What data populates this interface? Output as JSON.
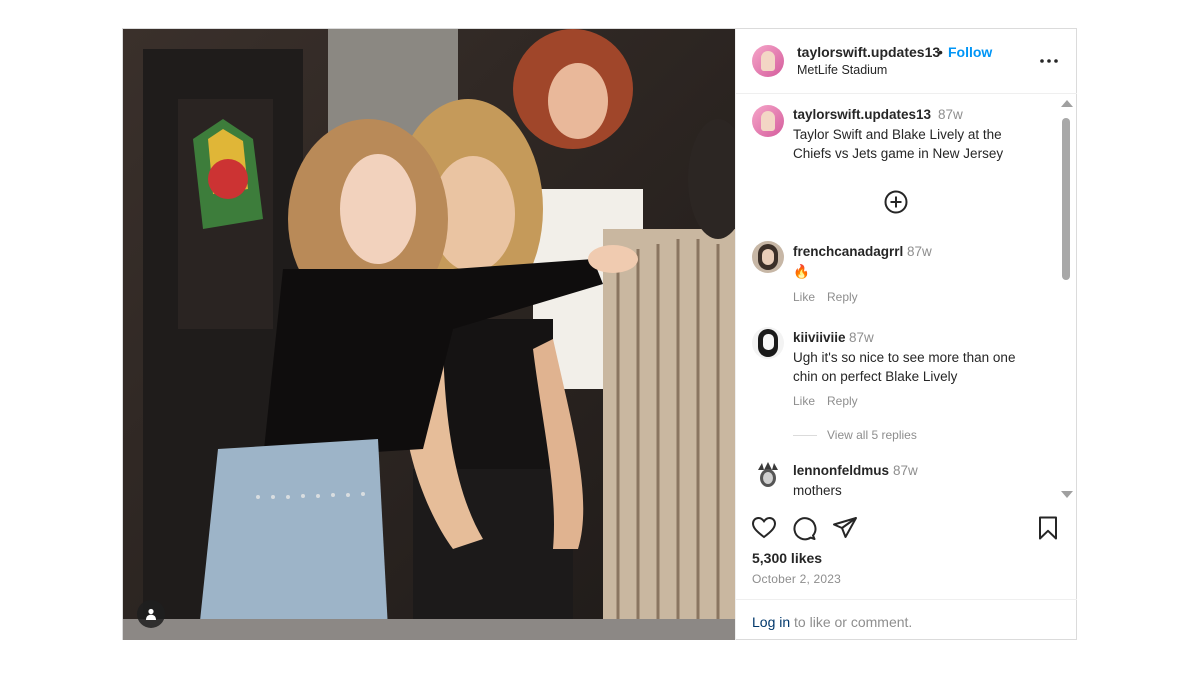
{
  "post": {
    "username": "taylorswift.updates13",
    "separator": "•",
    "follow_label": "Follow",
    "location": "MetLife Stadium",
    "likes": "5,300 likes",
    "date": "October 2, 2023"
  },
  "caption": {
    "username": "taylorswift.updates13",
    "time": "87w",
    "text": "Taylor Swift and Blake Lively at the Chiefs vs Jets game in New Jersey"
  },
  "comments": [
    {
      "username": "frenchcanadagrrl",
      "time": "87w",
      "text": "🔥",
      "like_label": "Like",
      "reply_label": "Reply"
    },
    {
      "username": "kiiviiviie",
      "time": "87w",
      "text": "Ugh it's so nice to see more than one chin on perfect Blake Lively",
      "like_label": "Like",
      "reply_label": "Reply",
      "view_replies": "View all 5 replies"
    },
    {
      "username": "lennonfeldmus",
      "time": "87w",
      "text": "mothers"
    }
  ],
  "footer": {
    "login_link": "Log in",
    "login_rest": " to like or comment."
  },
  "colors": {
    "follow_blue": "#0095f6",
    "link_dark": "#00376b",
    "muted": "#8e8e8e",
    "border": "#dbdbdb"
  },
  "icons": [
    "user-tag-icon",
    "more-options-icon",
    "add-circle-icon",
    "heart-icon",
    "comment-icon",
    "share-icon",
    "bookmark-icon",
    "fire-emoji"
  ]
}
